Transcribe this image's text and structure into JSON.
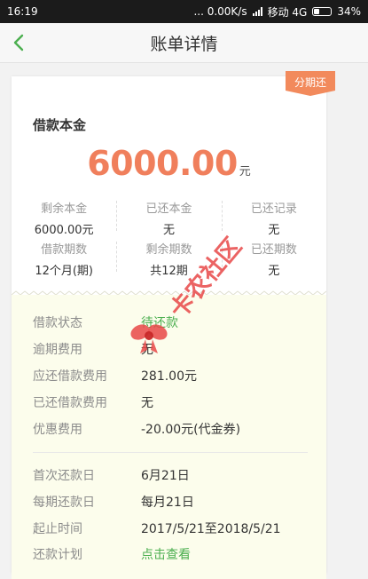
{
  "status_bar": {
    "time": "16:19",
    "network_speed": "... 0.00K/s",
    "carrier": "移动 4G",
    "battery": "34%"
  },
  "nav": {
    "title": "账单详情",
    "back_icon": "chevron-left-icon"
  },
  "card": {
    "badge": "分期还",
    "principal_label": "借款本金",
    "amount": "6000.00",
    "amount_unit": "元",
    "stats": [
      {
        "label": "剩余本金",
        "value": "6000.00元"
      },
      {
        "label": "已还本金",
        "value": "无"
      },
      {
        "label": "已还记录",
        "value": "无"
      },
      {
        "label": "借款期数",
        "value": "12个月(期)"
      },
      {
        "label": "剩余期数",
        "value": "共12期"
      },
      {
        "label": "已还期数",
        "value": "无"
      }
    ],
    "details_group1": [
      {
        "label": "借款状态",
        "value": "待还款"
      },
      {
        "label": "逾期费用",
        "value": "无"
      },
      {
        "label": "应还借款费用",
        "value": "281.00元"
      },
      {
        "label": "已还借款费用",
        "value": "无"
      },
      {
        "label": "优惠费用",
        "value": "-20.00元(代金券)"
      }
    ],
    "details_group2": [
      {
        "label": "首次还款日",
        "value": "6月21日"
      },
      {
        "label": "每期还款日",
        "value": "每月21日"
      },
      {
        "label": "起止时间",
        "value": "2017/5/21至2018/5/21"
      },
      {
        "label": "还款计划",
        "value": "点击查看"
      }
    ]
  },
  "watermark": {
    "text": "卡农社区"
  },
  "colors": {
    "accent_green": "#4caf50",
    "amount_orange": "#f07f5c",
    "badge_orange": "#f28a5c"
  }
}
